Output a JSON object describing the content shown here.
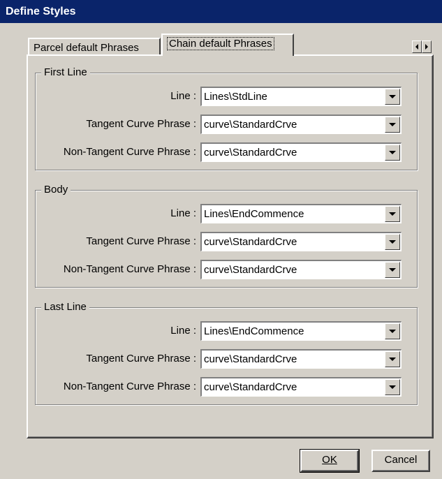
{
  "window": {
    "title": "Define Styles"
  },
  "tabs": [
    {
      "label": "Parcel default Phrases"
    },
    {
      "label": "Chain default Phrases"
    }
  ],
  "groups": [
    {
      "title": "First Line",
      "rows": [
        {
          "label": "Line :",
          "value": "Lines\\StdLine"
        },
        {
          "label": "Tangent Curve Phrase :",
          "value": "curve\\StandardCrve"
        },
        {
          "label": "Non-Tangent Curve Phrase :",
          "value": "curve\\StandardCrve"
        }
      ]
    },
    {
      "title": "Body",
      "rows": [
        {
          "label": "Line :",
          "value": "Lines\\EndCommence"
        },
        {
          "label": "Tangent Curve Phrase :",
          "value": "curve\\StandardCrve"
        },
        {
          "label": "Non-Tangent Curve Phrase :",
          "value": "curve\\StandardCrve"
        }
      ]
    },
    {
      "title": "Last Line",
      "rows": [
        {
          "label": "Line :",
          "value": "Lines\\EndCommence"
        },
        {
          "label": "Tangent Curve Phrase :",
          "value": "curve\\StandardCrve"
        },
        {
          "label": "Non-Tangent Curve Phrase :",
          "value": "curve\\StandardCrve"
        }
      ]
    }
  ],
  "buttons": {
    "ok": "OK",
    "cancel": "Cancel"
  },
  "colors": {
    "titlebar": "#0a246a",
    "face": "#d4d0c8"
  }
}
